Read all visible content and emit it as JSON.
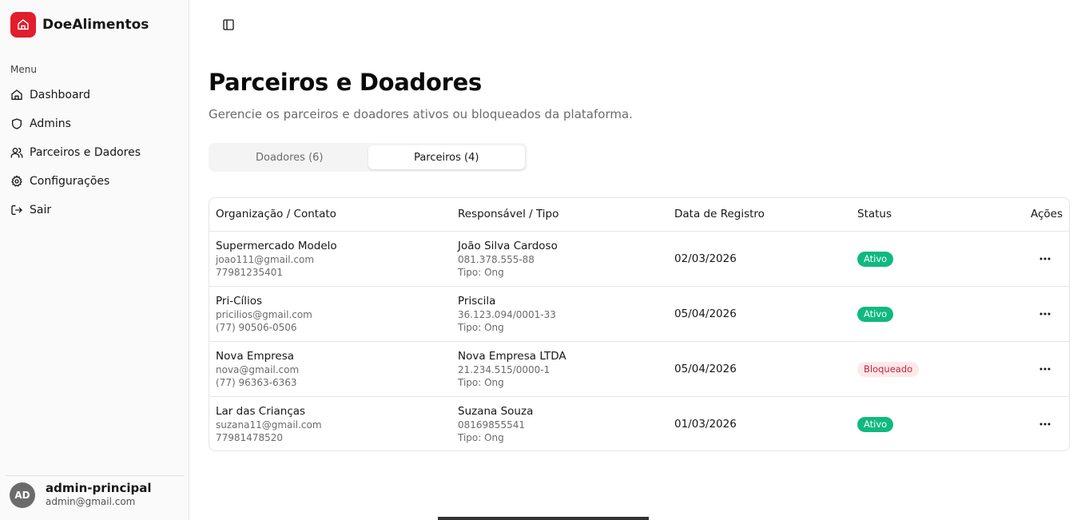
{
  "brand": {
    "name": "DoeAlimentos",
    "accent": "#e11d2e"
  },
  "sidebar": {
    "menu_label": "Menu",
    "items": [
      {
        "label": "Dashboard",
        "icon": "home-icon"
      },
      {
        "label": "Admins",
        "icon": "shield-icon"
      },
      {
        "label": "Parceiros e Dadores",
        "icon": "users-icon"
      },
      {
        "label": "Configurações",
        "icon": "gear-icon"
      },
      {
        "label": "Sair",
        "icon": "logout-icon"
      }
    ],
    "user": {
      "initials": "AD",
      "name": "admin-principal",
      "email": "admin@gmail.com"
    }
  },
  "header": {
    "toggle_icon": "sidebar-toggle-icon"
  },
  "page": {
    "title": "Parceiros e Doadores",
    "subtitle": "Gerencie os parceiros e doadores ativos ou bloqueados da plataforma."
  },
  "tabs": [
    {
      "label": "Doadores (6)",
      "active": false
    },
    {
      "label": "Parceiros (4)",
      "active": true
    }
  ],
  "table": {
    "headers": [
      "Organização / Contato",
      "Responsável / Tipo",
      "Data de Registro",
      "Status",
      "Ações"
    ],
    "rows": [
      {
        "org": "Supermercado Modelo",
        "email": "joao111@gmail.com",
        "phone": "77981235401",
        "responsavel": "João Silva Cardoso",
        "doc": "081.378.555-88",
        "tipo": "Tipo: Ong",
        "data": "02/03/2026",
        "status": "Ativo"
      },
      {
        "org": "Pri-Cílios",
        "email": "pricilios@gmail.com",
        "phone": "(77) 90506-0506",
        "responsavel": "Priscila",
        "doc": "36.123.094/0001-33",
        "tipo": "Tipo: Ong",
        "data": "05/04/2026",
        "status": "Ativo"
      },
      {
        "org": "Nova Empresa",
        "email": "nova@gmail.com",
        "phone": "(77) 96363-6363",
        "responsavel": "Nova Empresa LTDA",
        "doc": "21.234.515/0000-1",
        "tipo": "Tipo: Ong",
        "data": "05/04/2026",
        "status": "Bloqueado"
      },
      {
        "org": "Lar das Crianças",
        "email": "suzana11@gmail.com",
        "phone": "77981478520",
        "responsavel": "Suzana Souza",
        "doc": "08169855541",
        "tipo": "Tipo: Ong",
        "data": "01/03/2026",
        "status": "Ativo"
      }
    ]
  },
  "colors": {
    "status_ativo": "#10b981",
    "status_bloqueado_bg": "#fde8ea",
    "status_bloqueado_text": "#c0263b"
  }
}
